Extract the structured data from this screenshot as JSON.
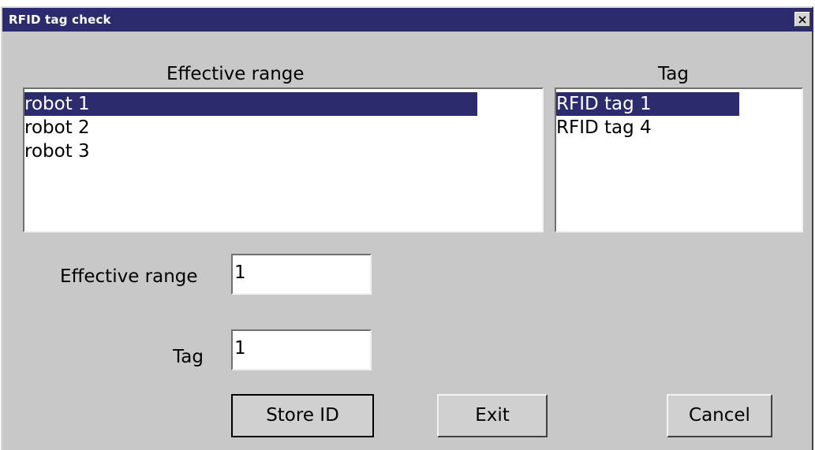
{
  "window": {
    "title": "RFID tag check",
    "close_symbol": "×"
  },
  "effective_range_list": {
    "header": "Effective range",
    "items": [
      "robot 1",
      "robot 2",
      "robot 3"
    ],
    "selected_index": 0
  },
  "tag_list": {
    "header": "Tag",
    "items": [
      "RFID tag 1",
      "RFID tag 4"
    ],
    "selected_index": 0
  },
  "fields": {
    "effective_range_label": "Effective range",
    "effective_range_value": "1",
    "tag_label": "Tag",
    "tag_value": "1"
  },
  "buttons": {
    "store_id": "Store ID",
    "exit": "Exit",
    "cancel": "Cancel"
  },
  "colors": {
    "titlebar": "#2b2b6e",
    "selection": "#2b2b6e",
    "window_bg": "#c8c8c8"
  }
}
